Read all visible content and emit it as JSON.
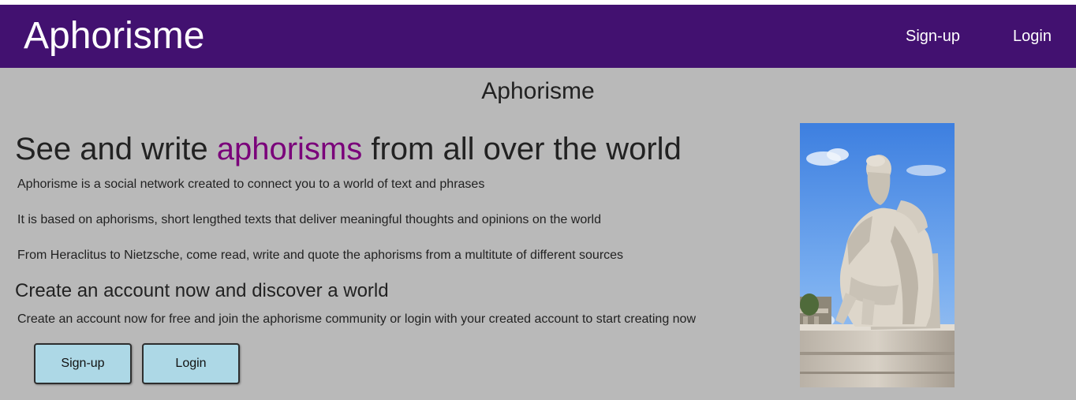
{
  "nav": {
    "brand": "Aphorisme",
    "links": [
      {
        "label": "Sign-up"
      },
      {
        "label": "Login"
      }
    ]
  },
  "main": {
    "title": "Aphorisme",
    "headline": {
      "before": "See and write ",
      "accent": "aphorisms",
      "after": " from all over the world"
    },
    "paragraphs": [
      "Aphorisme is a social network created to connect you to a world of text and phrases",
      "It is based on aphorisms, short lengthed texts that deliver meaningful thoughts and opinions on the world",
      "From Heraclitus to Nietzsche, come read, write and quote the aphorisms from a multitute of different sources"
    ],
    "subheading": "Create an account now and discover a world",
    "cta_text": "Create an account now for free and join the aphorisme community or login with your created account to start creating now",
    "buttons": {
      "signup": "Sign-up",
      "login": "Login"
    },
    "image": {
      "icon": "socrates-statue-image"
    }
  },
  "colors": {
    "navbar": "#421170",
    "background": "#b9b9b9",
    "accent": "#7a007a",
    "button": "#add8e6"
  }
}
